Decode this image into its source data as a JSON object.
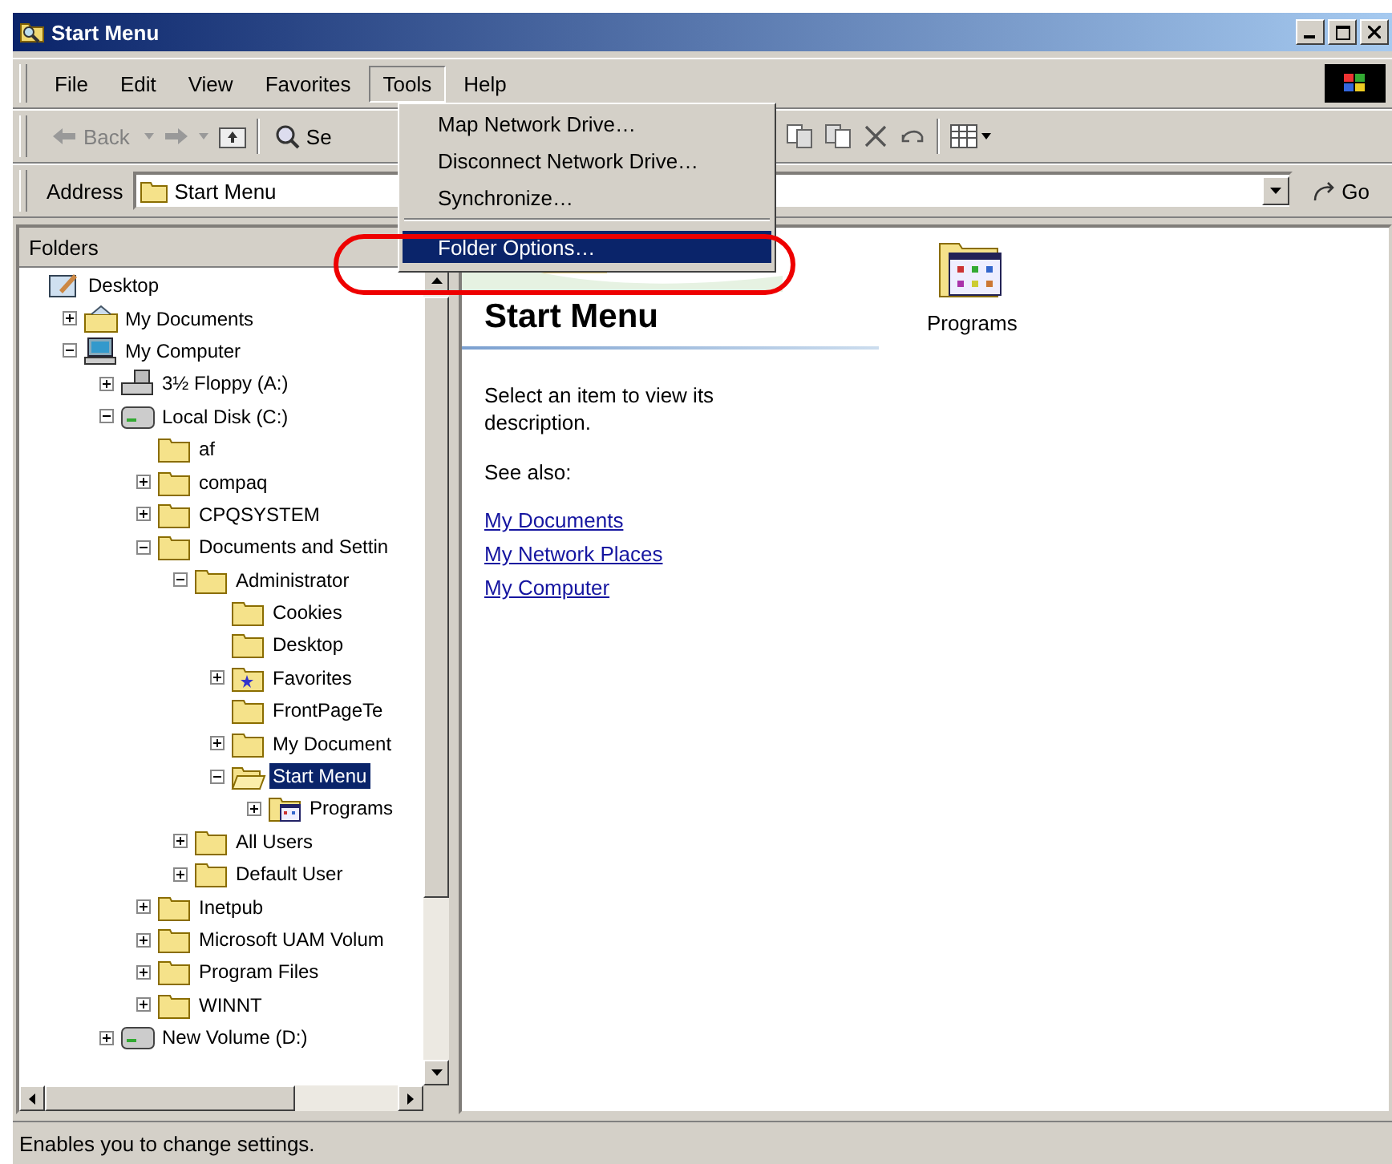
{
  "window": {
    "title": "Start Menu"
  },
  "menu_bar": [
    {
      "label": "File",
      "selected": false
    },
    {
      "label": "Edit",
      "selected": false
    },
    {
      "label": "View",
      "selected": false
    },
    {
      "label": "Favorites",
      "selected": false
    },
    {
      "label": "Tools",
      "selected": true
    },
    {
      "label": "Help",
      "selected": false
    }
  ],
  "tools_menu": [
    {
      "label": "Map Network Drive…",
      "selected": false
    },
    {
      "label": "Disconnect Network Drive…",
      "selected": false
    },
    {
      "label": "Synchronize…",
      "selected": false
    },
    {
      "label": "Folder Options…",
      "selected": true
    }
  ],
  "toolbar": {
    "back": {
      "label": "Back",
      "disabled": true
    },
    "search": {
      "label": "Se"
    }
  },
  "address_bar": {
    "label": "Address",
    "value": "Start Menu",
    "go": "Go"
  },
  "folders_pane": {
    "title": "Folders"
  },
  "tree": [
    {
      "label": "Desktop",
      "kind": "desktop",
      "selected": false,
      "children": [
        {
          "label": "My Documents",
          "kind": "documents",
          "expanded": false,
          "selected": false
        },
        {
          "label": "My Computer",
          "kind": "computer",
          "expanded": true,
          "selected": false,
          "children": [
            {
              "label": "3½ Floppy (A:)",
              "kind": "floppy",
              "expanded": false,
              "selected": false
            },
            {
              "label": "Local Disk (C:)",
              "kind": "disk",
              "expanded": true,
              "selected": false,
              "children": [
                {
                  "label": "af",
                  "kind": "folder",
                  "selected": false
                },
                {
                  "label": "compaq",
                  "kind": "folder",
                  "expanded": false,
                  "selected": false
                },
                {
                  "label": "CPQSYSTEM",
                  "kind": "folder",
                  "expanded": false,
                  "selected": false
                },
                {
                  "label": "Documents and Settin",
                  "kind": "folder",
                  "expanded": true,
                  "selected": false,
                  "children": [
                    {
                      "label": "Administrator",
                      "kind": "folder",
                      "expanded": true,
                      "selected": false,
                      "children": [
                        {
                          "label": "Cookies",
                          "kind": "folder",
                          "selected": false
                        },
                        {
                          "label": "Desktop",
                          "kind": "folder",
                          "selected": false
                        },
                        {
                          "label": "Favorites",
                          "kind": "favorites",
                          "expanded": false,
                          "selected": false
                        },
                        {
                          "label": "FrontPageTe",
                          "kind": "folder",
                          "selected": false
                        },
                        {
                          "label": "My Document",
                          "kind": "folder",
                          "expanded": false,
                          "selected": false
                        },
                        {
                          "label": "Start Menu",
                          "kind": "open-folder",
                          "expanded": true,
                          "selected": true,
                          "children": [
                            {
                              "label": "Programs",
                              "kind": "programs",
                              "expanded": false,
                              "selected": false
                            }
                          ]
                        }
                      ]
                    },
                    {
                      "label": "All Users",
                      "kind": "folder",
                      "expanded": false,
                      "selected": false
                    },
                    {
                      "label": "Default User",
                      "kind": "folder",
                      "expanded": false,
                      "selected": false
                    }
                  ]
                },
                {
                  "label": "Inetpub",
                  "kind": "folder",
                  "expanded": false,
                  "selected": false
                },
                {
                  "label": "Microsoft UAM Volum",
                  "kind": "folder",
                  "expanded": false,
                  "selected": false
                },
                {
                  "label": "Program Files",
                  "kind": "folder",
                  "expanded": false,
                  "selected": false
                },
                {
                  "label": "WINNT",
                  "kind": "folder",
                  "expanded": false,
                  "selected": false
                }
              ]
            },
            {
              "label": "New Volume (D:)",
              "kind": "disk",
              "expanded": false,
              "selected": false
            }
          ]
        }
      ]
    }
  ],
  "web_view": {
    "heading": "Start Menu",
    "description": "Select an item to view its description.",
    "see_also": "See also:",
    "links": [
      "My Documents",
      "My Network Places",
      "My Computer"
    ]
  },
  "items": [
    {
      "label": "Programs",
      "kind": "programs"
    }
  ],
  "status_bar": "Enables you to change settings."
}
